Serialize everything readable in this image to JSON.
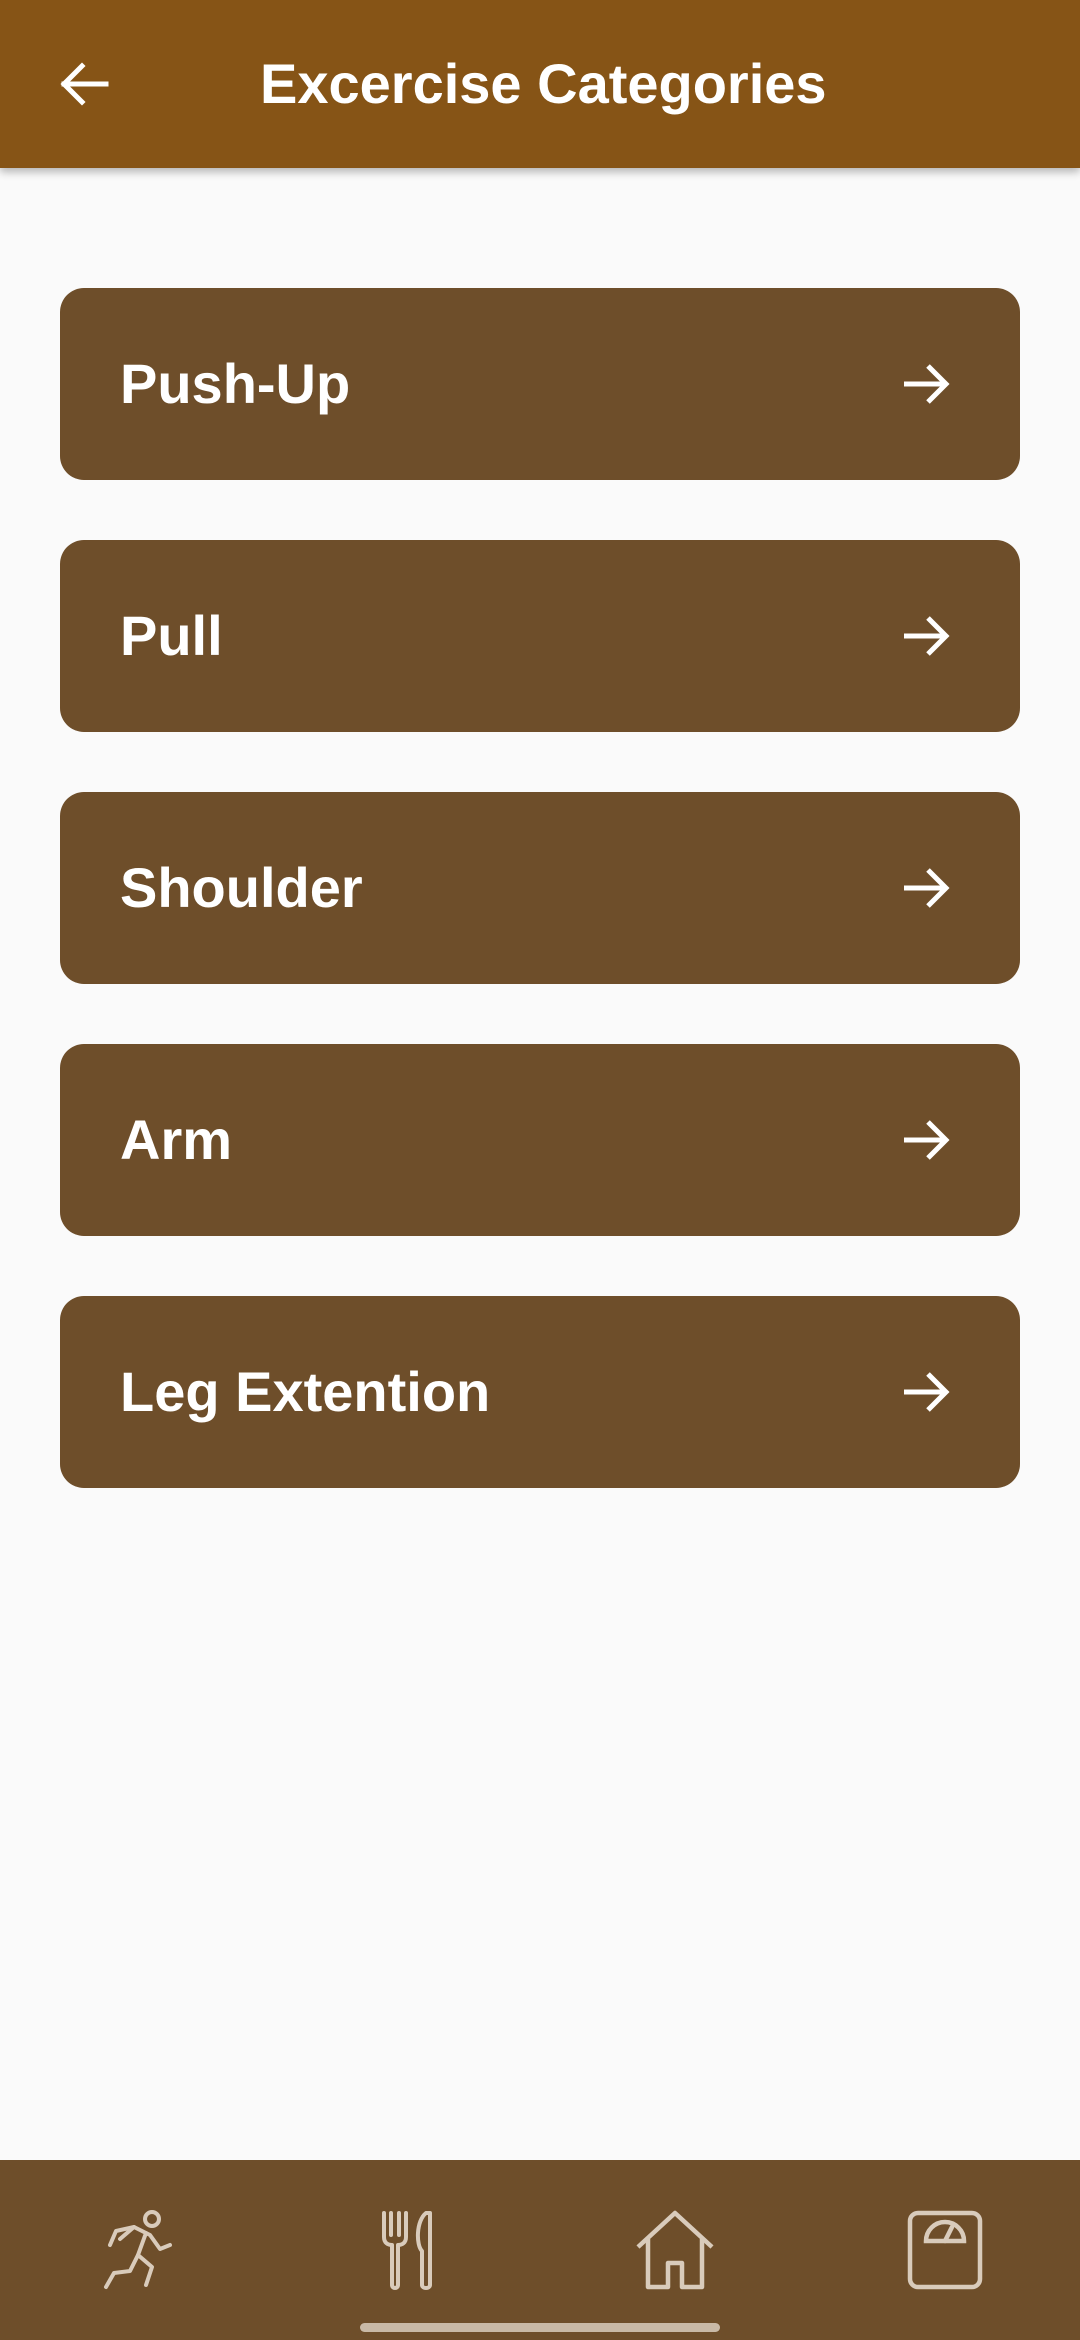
{
  "header": {
    "title": "Excercise Categories",
    "back_icon": "arrow-back-icon"
  },
  "categories": [
    {
      "label": "Push-Up",
      "icon": "arrow-forward-icon"
    },
    {
      "label": "Pull",
      "icon": "arrow-forward-icon"
    },
    {
      "label": "Shoulder",
      "icon": "arrow-forward-icon"
    },
    {
      "label": "Arm",
      "icon": "arrow-forward-icon"
    },
    {
      "label": "Leg Extention",
      "icon": "arrow-forward-icon"
    }
  ],
  "bottom_nav": [
    {
      "icon": "running-person-icon"
    },
    {
      "icon": "fork-knife-icon"
    },
    {
      "icon": "home-icon"
    },
    {
      "icon": "scale-icon"
    }
  ],
  "colors": {
    "app_bar": "#865416",
    "card": "#6e4e2a",
    "background": "#fafafa",
    "nav_bar": "#6e4e2a",
    "nav_icon": "#d9cbbb",
    "text": "#ffffff"
  }
}
